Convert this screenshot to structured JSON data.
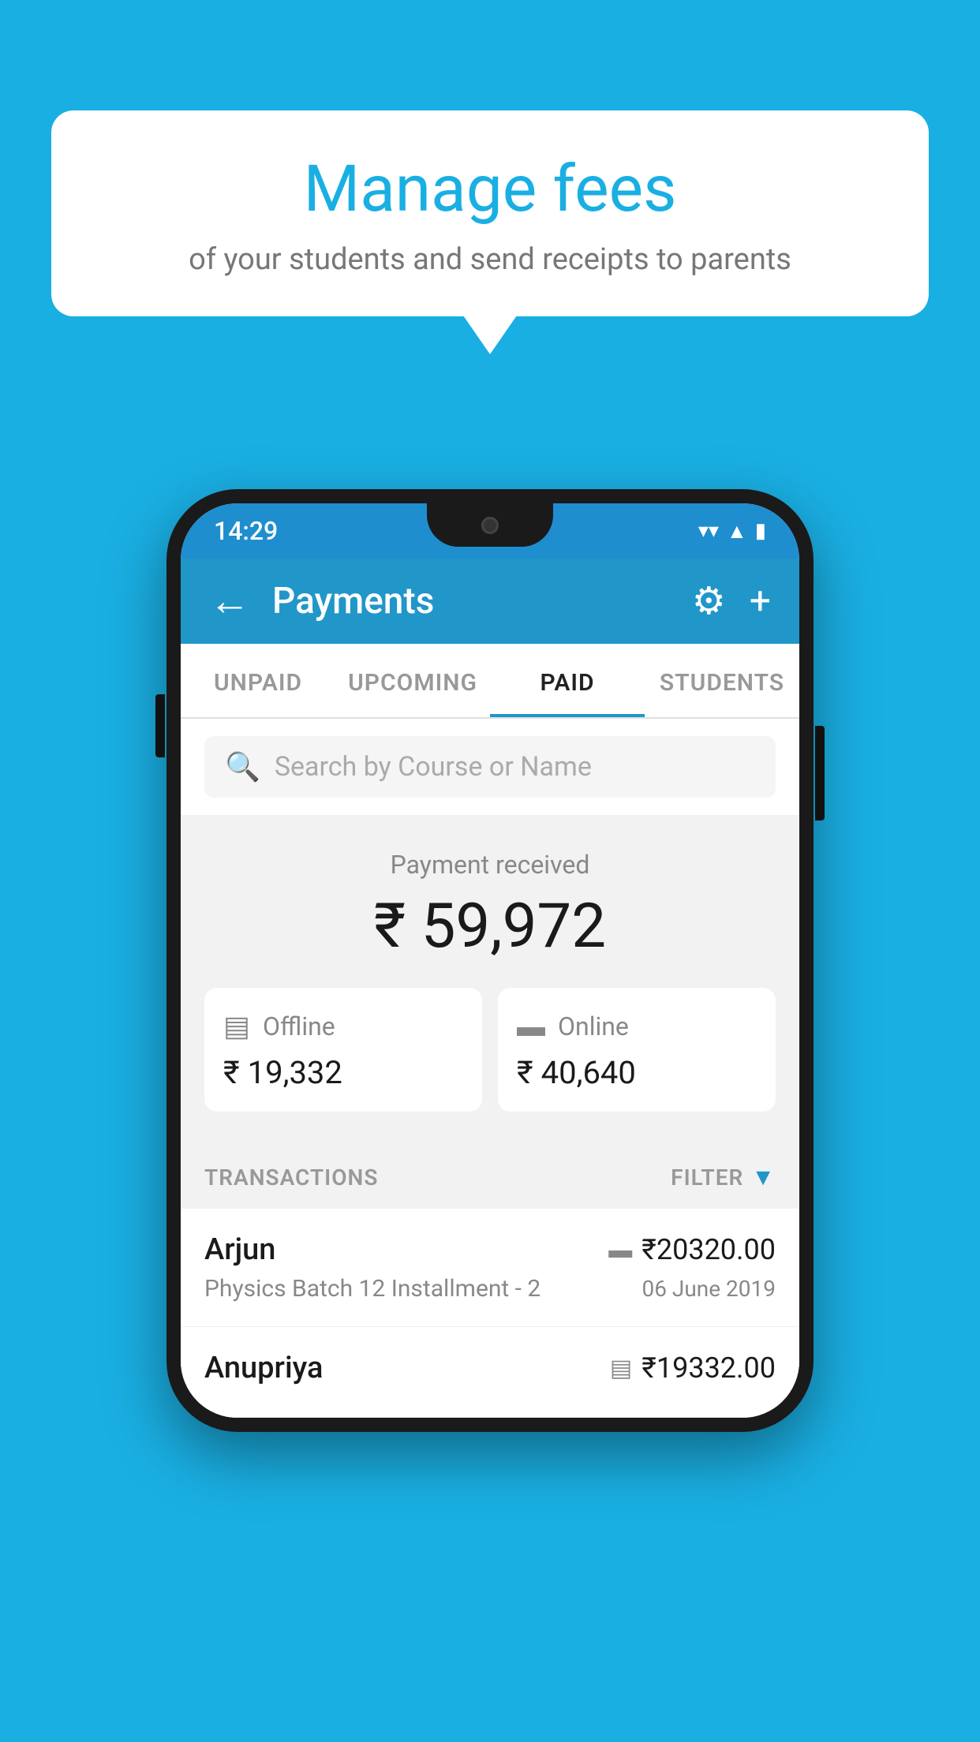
{
  "bubble": {
    "title": "Manage fees",
    "subtitle": "of your students and send receipts to parents"
  },
  "phone": {
    "status_bar": {
      "time": "14:29",
      "wifi": "▼",
      "signal": "▲",
      "battery": "▮"
    },
    "header": {
      "title": "Payments",
      "back_label": "←",
      "gear_label": "⚙",
      "plus_label": "+"
    },
    "tabs": [
      {
        "label": "UNPAID",
        "active": false
      },
      {
        "label": "UPCOMING",
        "active": false
      },
      {
        "label": "PAID",
        "active": true
      },
      {
        "label": "STUDENTS",
        "active": false
      }
    ],
    "search": {
      "placeholder": "Search by Course or Name"
    },
    "payment_summary": {
      "label": "Payment received",
      "amount": "₹ 59,972",
      "offline_label": "Offline",
      "offline_amount": "₹ 19,332",
      "online_label": "Online",
      "online_amount": "₹ 40,640"
    },
    "transactions_header": {
      "label": "TRANSACTIONS",
      "filter_label": "FILTER"
    },
    "transactions": [
      {
        "name": "Arjun",
        "course": "Physics Batch 12 Installment - 2",
        "amount": "₹20320.00",
        "date": "06 June 2019",
        "type": "online"
      },
      {
        "name": "Anupriya",
        "course": "",
        "amount": "₹19332.00",
        "date": "",
        "type": "offline"
      }
    ]
  }
}
